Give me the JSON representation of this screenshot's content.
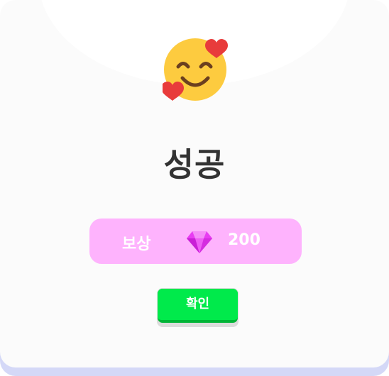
{
  "dialog": {
    "title": "성공",
    "emoji_icon": "smiling-face-with-hearts-icon",
    "reward": {
      "label": "보상",
      "icon": "gem-icon",
      "amount": "200"
    },
    "confirm_label": "확인"
  },
  "colors": {
    "card_background": "#fbfbfb",
    "card_shadow": "#d4d8f7",
    "title_text": "#333333",
    "reward_pill": "#feb3fd",
    "gem": "#e83cf2",
    "confirm_button": "#00ea4b",
    "heart": "#e83b3b",
    "emoji_face": "#fdcb3f"
  }
}
